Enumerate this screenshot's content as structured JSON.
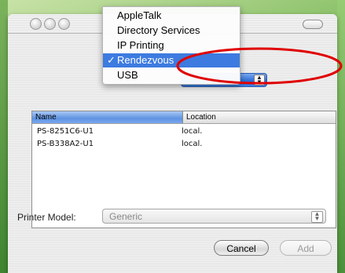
{
  "menu": {
    "items": [
      {
        "label": "AppleTalk",
        "selected": false
      },
      {
        "label": "Directory Services",
        "selected": false
      },
      {
        "label": "IP Printing",
        "selected": false
      },
      {
        "label": "Rendezvous",
        "selected": true
      },
      {
        "label": "USB",
        "selected": false
      }
    ],
    "check_glyph": "✓"
  },
  "list": {
    "headers": {
      "name": "Name",
      "location": "Location"
    },
    "rows": [
      {
        "name": "PS-8251C6-U1",
        "location": "local."
      },
      {
        "name": "PS-B338A2-U1",
        "location": "local."
      }
    ]
  },
  "printer_model": {
    "label": "Printer Model:",
    "value": "Generic"
  },
  "buttons": {
    "cancel": "Cancel",
    "add": "Add"
  },
  "colors": {
    "selection": "#3d7be0",
    "annotation": "#e00000"
  }
}
